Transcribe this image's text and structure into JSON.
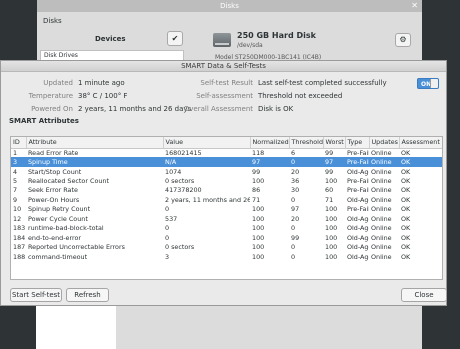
{
  "disks_window": {
    "title": "Disks",
    "menu_label": "Disks",
    "devices_label": "Devices",
    "check_icon": "✔",
    "disk_drives_label": "Disk Drives",
    "drive_title": "250 GB Hard Disk",
    "drive_device": "/dev/sda",
    "drive_model": "Model   ST250DM000-1BC141 (IC4B)",
    "gear_icon": "⚙",
    "close_icon": "✕"
  },
  "dialog": {
    "title": "SMART Data & Self-Tests",
    "updated_label": "Updated",
    "updated_value": "1 minute ago",
    "temperature_label": "Temperature",
    "temperature_value": "38° C / 100° F",
    "powered_on_label": "Powered On",
    "powered_on_value": "2 years, 11 months and 26 days",
    "self_test_label": "Self-test Result",
    "self_test_value": "Last self-test completed successfully",
    "self_assessment_label": "Self-assessment",
    "self_assessment_value": "Threshold not exceeded",
    "overall_label": "Overall Assessment",
    "overall_value": "Disk is OK",
    "toggle_label": "ON",
    "section_title": "SMART Attributes",
    "start_button": "Start Self-test",
    "refresh_button": "Refresh",
    "close_button": "Close"
  },
  "table": {
    "headers": [
      "ID",
      "Attribute",
      "Value",
      "Normalized",
      "Threshold",
      "Worst",
      "Type",
      "Updates",
      "Assessment"
    ],
    "rows": [
      [
        "1",
        "Read Error Rate",
        "168021415",
        "118",
        "6",
        "99",
        "Pre-Fail",
        "Online",
        "OK"
      ],
      [
        "3",
        "Spinup Time",
        "N/A",
        "97",
        "0",
        "97",
        "Pre-Fail",
        "Online",
        "OK"
      ],
      [
        "4",
        "Start/Stop Count",
        "1074",
        "99",
        "20",
        "99",
        "Old-Age",
        "Online",
        "OK"
      ],
      [
        "5",
        "Reallocated Sector Count",
        "0 sectors",
        "100",
        "36",
        "100",
        "Pre-Fail",
        "Online",
        "OK"
      ],
      [
        "7",
        "Seek Error Rate",
        "417378200",
        "86",
        "30",
        "60",
        "Pre-Fail",
        "Online",
        "OK"
      ],
      [
        "9",
        "Power-On Hours",
        "2 years, 11 months and 26 days",
        "71",
        "0",
        "71",
        "Old-Age",
        "Online",
        "OK"
      ],
      [
        "10",
        "Spinup Retry Count",
        "0",
        "100",
        "97",
        "100",
        "Pre-Fail",
        "Online",
        "OK"
      ],
      [
        "12",
        "Power Cycle Count",
        "537",
        "100",
        "20",
        "100",
        "Old-Age",
        "Online",
        "OK"
      ],
      [
        "183",
        "runtime-bad-block-total",
        "0",
        "100",
        "0",
        "100",
        "Old-Age",
        "Online",
        "OK"
      ],
      [
        "184",
        "end-to-end-error",
        "0",
        "100",
        "99",
        "100",
        "Old-Age",
        "Online",
        "OK"
      ],
      [
        "187",
        "Reported Uncorrectable Errors",
        "0 sectors",
        "100",
        "0",
        "100",
        "Old-Age",
        "Online",
        "OK"
      ],
      [
        "188",
        "command-timeout",
        "3",
        "100",
        "0",
        "100",
        "Old-Age",
        "Online",
        "OK"
      ]
    ],
    "selected_row": 1
  },
  "colors": {
    "accent": "#4a90d9"
  }
}
